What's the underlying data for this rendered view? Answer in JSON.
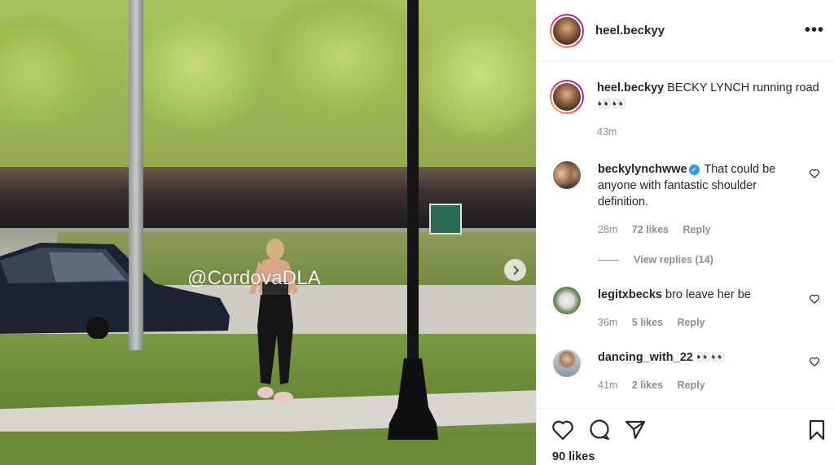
{
  "photo": {
    "watermark": "@CordovaDLA",
    "next_icon": "chevron-right-icon"
  },
  "header": {
    "username": "heel.beckyy",
    "more_icon": "more-horizontal-icon",
    "more_label": "•••"
  },
  "caption": {
    "username": "heel.beckyy",
    "text": "BECKY LYNCH running road 👀👀",
    "time": "43m"
  },
  "comments": [
    {
      "username": "beckylynchwwe",
      "verified": true,
      "text": "That could be anyone with fantastic shoulder definition.",
      "time": "28m",
      "likes": "72 likes",
      "reply": "Reply",
      "view_replies": "View replies (14)"
    },
    {
      "username": "legitxbecks",
      "verified": false,
      "text": "bro leave her be",
      "time": "36m",
      "likes": "5 likes",
      "reply": "Reply"
    },
    {
      "username": "dancing_with_22",
      "verified": false,
      "text": "👀👀",
      "time": "41m",
      "likes": "2 likes",
      "reply": "Reply"
    }
  ],
  "actions": {
    "like_icon": "heart-icon",
    "comment_icon": "comment-icon",
    "share_icon": "send-icon",
    "save_icon": "bookmark-icon",
    "likes": "90 likes"
  },
  "colors": {
    "verified": "#3897f0",
    "muted": "#8e8e8e",
    "text": "#262626"
  }
}
